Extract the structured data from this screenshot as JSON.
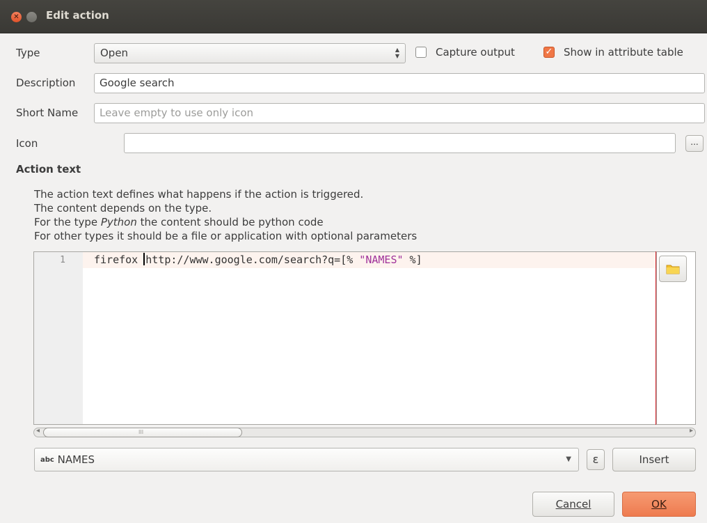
{
  "window": {
    "title": "Edit action"
  },
  "form": {
    "type_label": "Type",
    "type_value": "Open",
    "capture_output_label": "Capture output",
    "capture_output_checked": false,
    "show_in_table_label": "Show in attribute table",
    "show_in_table_checked": true,
    "description_label": "Description",
    "description_value": "Google search",
    "short_name_label": "Short Name",
    "short_name_placeholder": "Leave empty to use only icon",
    "icon_label": "Icon",
    "icon_value": "",
    "icon_browse_label": "..."
  },
  "action_text": {
    "heading": "Action text",
    "help_line1": "The action text defines what happens if the action is triggered.",
    "help_line2": "The content depends on the type.",
    "help_line3_pre": "For the type ",
    "help_line3_em": "Python",
    "help_line3_post": " the content should be python code",
    "help_line4": "For other types it should be a file or application with optional parameters",
    "line_number": "1",
    "code_part1": "firefox ",
    "code_part2": "http://www.google.com/search?q=[% ",
    "code_string": "\"NAMES\"",
    "code_part3": " %]"
  },
  "scrollbar": {
    "thumb_grip": "III"
  },
  "field_picker": {
    "type_badge": "abc",
    "value": "NAMES",
    "expression_label": "ε",
    "insert_label": "Insert"
  },
  "buttons": {
    "cancel_label": "Cancel",
    "ok_label": "OK"
  },
  "colors": {
    "accent": "#f07746",
    "titlebar": "#3c3b37",
    "edge_line": "#d6242c"
  }
}
